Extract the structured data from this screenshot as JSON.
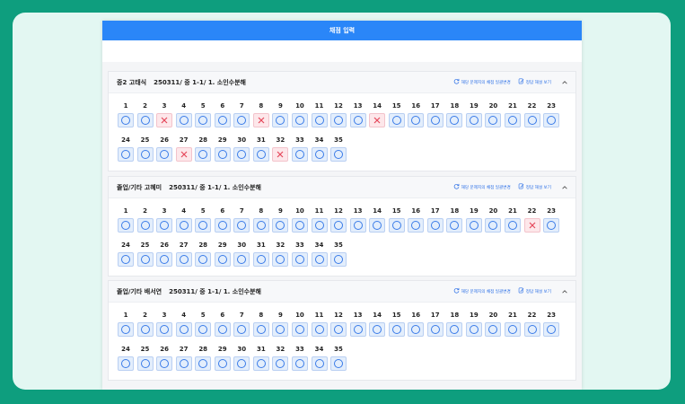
{
  "panel": {
    "title": "채점 입력"
  },
  "actions": {
    "reset_label": "해당 문제지의 채점 일괄변경",
    "answer_label": "정답 해설 보기"
  },
  "colors": {
    "accent": "#2a86f8",
    "correct": "#3a7be8",
    "wrong": "#e5475a",
    "frame": "#0e9e7e"
  },
  "cards": [
    {
      "student": "중2 고태식",
      "exam": "250311/ 중 1-1/ 1. 소인수분해",
      "results": [
        "O",
        "O",
        "X",
        "O",
        "O",
        "O",
        "O",
        "X",
        "O",
        "O",
        "O",
        "O",
        "O",
        "X",
        "O",
        "O",
        "O",
        "O",
        "O",
        "O",
        "O",
        "O",
        "O",
        "O",
        "O",
        "O",
        "X",
        "O",
        "O",
        "O",
        "O",
        "X",
        "O",
        "O",
        "O"
      ]
    },
    {
      "student": "졸업/기타 고혜미",
      "exam": "250311/ 중 1-1/ 1. 소인수분해",
      "results": [
        "O",
        "O",
        "O",
        "O",
        "O",
        "O",
        "O",
        "O",
        "O",
        "O",
        "O",
        "O",
        "O",
        "O",
        "O",
        "O",
        "O",
        "O",
        "O",
        "O",
        "O",
        "X",
        "O",
        "O",
        "O",
        "O",
        "O",
        "O",
        "O",
        "O",
        "O",
        "O",
        "O",
        "O",
        "O"
      ]
    },
    {
      "student": "졸업/기타 배서연",
      "exam": "250311/ 중 1-1/ 1. 소인수분해",
      "results": [
        "O",
        "O",
        "O",
        "O",
        "O",
        "O",
        "O",
        "O",
        "O",
        "O",
        "O",
        "O",
        "O",
        "O",
        "O",
        "O",
        "O",
        "O",
        "O",
        "O",
        "O",
        "O",
        "O",
        "O",
        "O",
        "O",
        "O",
        "O",
        "O",
        "O",
        "O",
        "O",
        "O",
        "O",
        "O"
      ]
    }
  ],
  "question_numbers": [
    "1",
    "2",
    "3",
    "4",
    "5",
    "6",
    "7",
    "8",
    "9",
    "10",
    "11",
    "12",
    "13",
    "14",
    "15",
    "16",
    "17",
    "18",
    "19",
    "20",
    "21",
    "22",
    "23",
    "24",
    "25",
    "26",
    "27",
    "28",
    "29",
    "30",
    "31",
    "32",
    "33",
    "34",
    "35"
  ]
}
